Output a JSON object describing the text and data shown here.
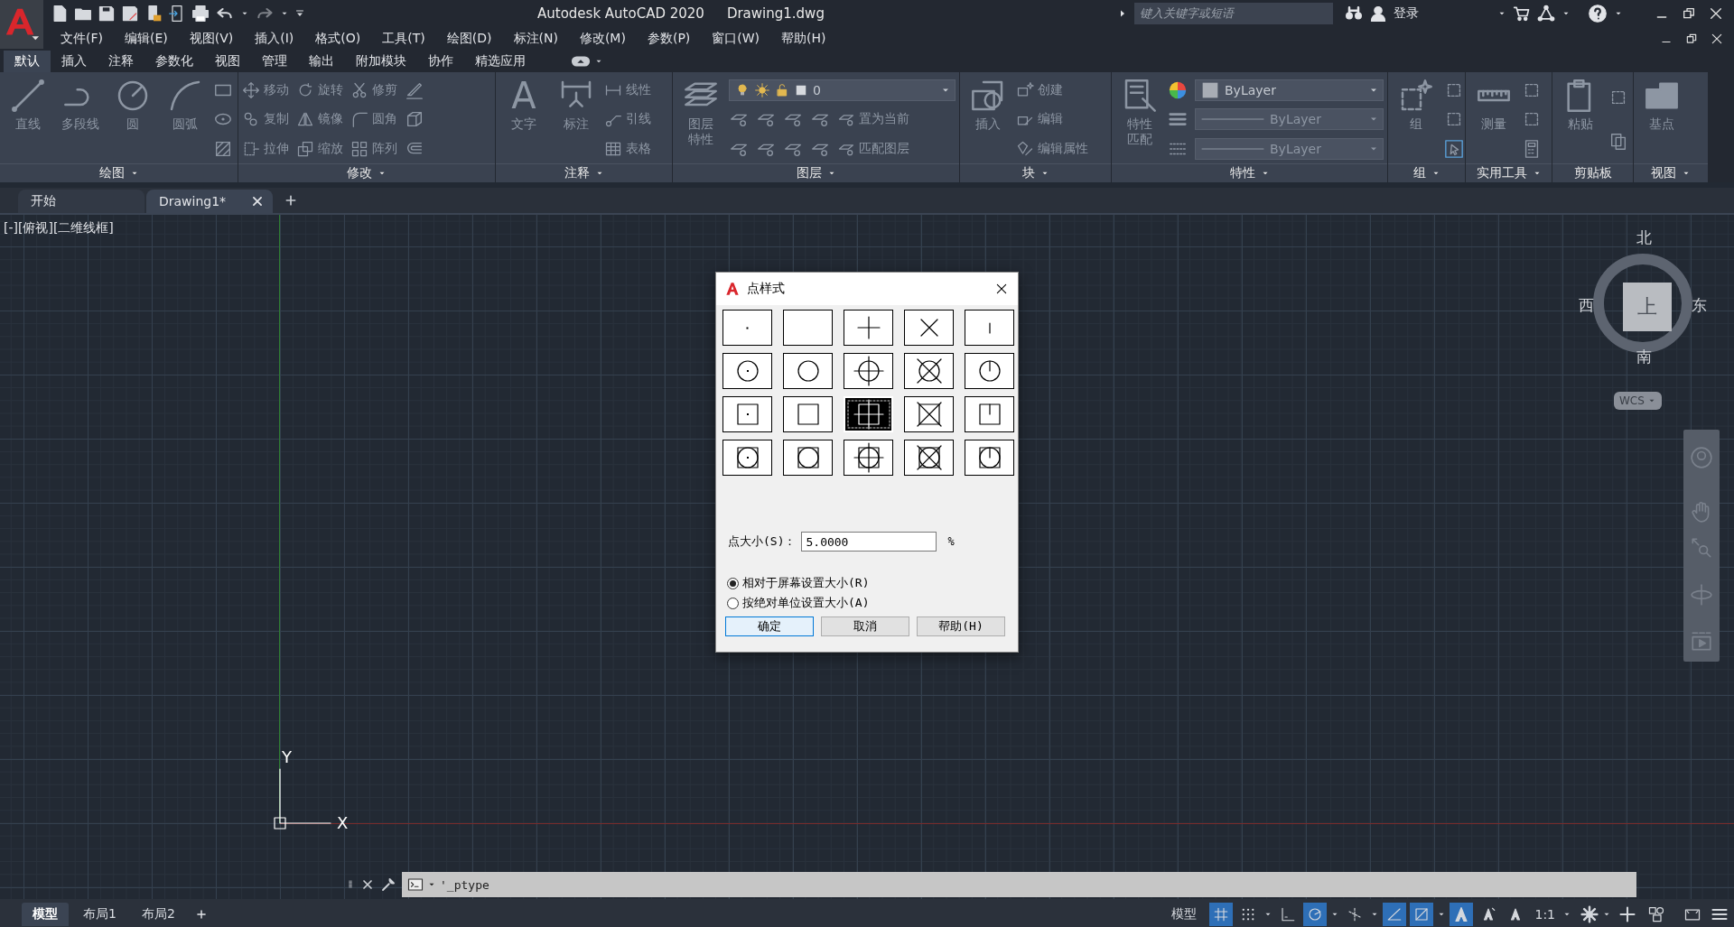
{
  "title_bar": {
    "title": "Autodesk AutoCAD 2020",
    "document": "Drawing1.dwg",
    "search": {
      "placeholder": "键入关键字或短语"
    },
    "sign_in": "登录"
  },
  "menu_bar": [
    "文件(F)",
    "编辑(E)",
    "视图(V)",
    "插入(I)",
    "格式(O)",
    "工具(T)",
    "绘图(D)",
    "标注(N)",
    "修改(M)",
    "参数(P)",
    "窗口(W)",
    "帮助(H)"
  ],
  "ribbon": {
    "tabs": [
      {
        "label": "默认",
        "selected": true
      },
      {
        "label": "插入",
        "selected": false
      },
      {
        "label": "注释",
        "selected": false
      },
      {
        "label": "参数化",
        "selected": false
      },
      {
        "label": "视图",
        "selected": false
      },
      {
        "label": "管理",
        "selected": false
      },
      {
        "label": "输出",
        "selected": false
      },
      {
        "label": "附加模块",
        "selected": false
      },
      {
        "label": "协作",
        "selected": false
      },
      {
        "label": "精选应用",
        "selected": false
      }
    ],
    "panels": [
      {
        "title": "绘图",
        "menu": true,
        "large": [
          {
            "label": "直线"
          },
          {
            "label": "多段线"
          },
          {
            "label": "圆"
          },
          {
            "label": "圆弧"
          }
        ],
        "rows": [
          [
            {
              "kind": "tool"
            }
          ],
          [
            {
              "kind": "tool"
            }
          ],
          [
            {
              "kind": "tool"
            }
          ]
        ]
      },
      {
        "title": "修改",
        "menu": true,
        "rows": [
          [
            {
              "kind": "tool",
              "label": "移动"
            },
            {
              "kind": "tool",
              "label": "旋转"
            },
            {
              "kind": "tool",
              "label": "修剪"
            },
            {
              "kind": "tool"
            }
          ],
          [
            {
              "kind": "tool",
              "label": "复制"
            },
            {
              "kind": "tool",
              "label": "镜像"
            },
            {
              "kind": "tool",
              "label": "圆角"
            },
            {
              "kind": "tool"
            }
          ],
          [
            {
              "kind": "tool",
              "label": "拉伸"
            },
            {
              "kind": "tool",
              "label": "缩放"
            },
            {
              "kind": "tool",
              "label": "阵列"
            },
            {
              "kind": "tool"
            }
          ]
        ]
      },
      {
        "title": "注释",
        "menu": true,
        "large": [
          {
            "label": "文字",
            "glyph": "A"
          },
          {
            "label": "标注"
          }
        ],
        "rows": [
          [
            {
              "kind": "tool",
              "label": "线性"
            }
          ],
          [
            {
              "kind": "tool",
              "label": "引线"
            }
          ],
          [
            {
              "kind": "tool",
              "label": "表格"
            }
          ]
        ]
      },
      {
        "title": "图层",
        "menu": true,
        "large": [
          {
            "label": "图层特性"
          }
        ],
        "rows": [
          [
            {
              "kind": "layer-dropdown",
              "value": "0"
            }
          ],
          [
            {
              "kind": "tool"
            },
            {
              "kind": "tool"
            },
            {
              "kind": "tool"
            },
            {
              "kind": "tool"
            },
            {
              "kind": "tool",
              "label": "置为当前"
            }
          ],
          [
            {
              "kind": "tool"
            },
            {
              "kind": "tool"
            },
            {
              "kind": "tool"
            },
            {
              "kind": "tool"
            },
            {
              "kind": "tool",
              "label": "匹配图层"
            }
          ]
        ]
      },
      {
        "title": "块",
        "menu": true,
        "large": [
          {
            "label": "插入"
          }
        ],
        "rows": [
          [
            {
              "kind": "tool",
              "label": "创建"
            }
          ],
          [
            {
              "kind": "tool",
              "label": "编辑"
            }
          ],
          [
            {
              "kind": "tool",
              "label": "编辑属性"
            }
          ]
        ]
      },
      {
        "title": "特性",
        "menu": true,
        "large": [
          {
            "label": "特性匹配"
          }
        ],
        "rows": [
          [
            {
              "kind": "tool"
            },
            {
              "kind": "color-dropdown",
              "value": "ByLayer"
            }
          ],
          [
            {
              "kind": "tool"
            },
            {
              "kind": "line-dropdown",
              "value": "ByLayer"
            }
          ],
          [
            {
              "kind": "tool"
            },
            {
              "kind": "line-dropdown",
              "value": "ByLayer"
            }
          ]
        ]
      },
      {
        "title": "组",
        "menu": true,
        "large": [
          {
            "label": "组"
          }
        ],
        "rows": [
          [
            {
              "kind": "tool"
            }
          ],
          [
            {
              "kind": "tool"
            }
          ],
          [
            {
              "kind": "tool"
            }
          ]
        ]
      },
      {
        "title": "实用工具",
        "menu": true,
        "large": [
          {
            "label": "测量"
          }
        ],
        "rows": [
          [
            {
              "kind": "tool"
            }
          ],
          [
            {
              "kind": "tool"
            }
          ],
          [
            {
              "kind": "tool"
            }
          ]
        ]
      },
      {
        "title": "剪贴板",
        "menu": false,
        "large": [
          {
            "label": "粘贴"
          }
        ],
        "rows": [
          [
            {
              "kind": "tool"
            }
          ],
          [
            {
              "kind": "tool"
            }
          ]
        ]
      },
      {
        "title": "视图",
        "menu": true,
        "large": [
          {
            "label": "基点"
          }
        ]
      }
    ]
  },
  "document_tabs": [
    {
      "label": "开始",
      "selected": false
    },
    {
      "label": "Drawing1*",
      "selected": true
    }
  ],
  "viewport": {
    "label": "[-][俯视][二维线框]",
    "ucs": {
      "y": "Y",
      "x": "X"
    },
    "viewcube": {
      "north": "北",
      "west": "西",
      "top": "上",
      "east": "东",
      "south": "南",
      "coordinate_system": "WCS"
    }
  },
  "dialog": {
    "title": "点样式",
    "styles": [
      {
        "selected": false
      },
      {
        "selected": false
      },
      {
        "selected": false
      },
      {
        "selected": false
      },
      {
        "selected": false
      },
      {
        "selected": false
      },
      {
        "selected": false
      },
      {
        "selected": false
      },
      {
        "selected": false
      },
      {
        "selected": false
      },
      {
        "selected": false
      },
      {
        "selected": false
      },
      {
        "selected": true
      },
      {
        "selected": false
      },
      {
        "selected": false
      },
      {
        "selected": false
      },
      {
        "selected": false
      },
      {
        "selected": false
      },
      {
        "selected": false
      },
      {
        "selected": false
      }
    ],
    "size_label": "点大小(S)：",
    "size_value": "5.0000",
    "size_unit": "%",
    "size_modes": [
      {
        "label": "相对于屏幕设置大小(R)",
        "selected": true
      },
      {
        "label": "按绝对单位设置大小(A)",
        "selected": false
      }
    ],
    "buttons": [
      {
        "label": "确定",
        "default": true
      },
      {
        "label": "取消",
        "default": false
      },
      {
        "label": "帮助(H)",
        "default": false
      }
    ]
  },
  "command_line": {
    "text": "'_ptype"
  },
  "layout_tabs": [
    {
      "label": "模型",
      "selected": true
    },
    {
      "label": "布局1",
      "selected": false
    },
    {
      "label": "布局2",
      "selected": false
    }
  ],
  "status_bar": {
    "space": "模型",
    "toggles": [
      {
        "on": true
      },
      {
        "on": false
      },
      {
        "on": false
      },
      {
        "on": true
      },
      {
        "on": false
      },
      {
        "on": true
      },
      {
        "on": true
      },
      {
        "on": true
      },
      {
        "on": false
      },
      {
        "on": false
      }
    ],
    "scale": "1:1"
  }
}
